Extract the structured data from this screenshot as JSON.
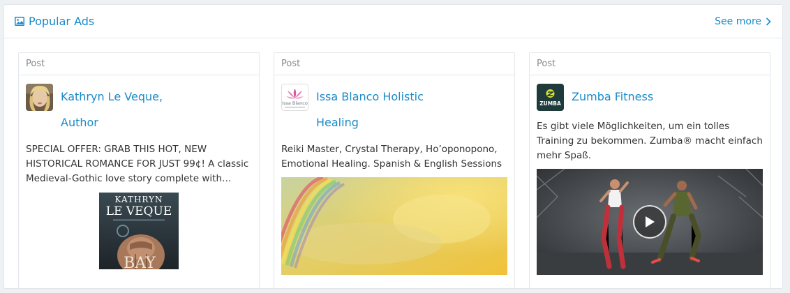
{
  "header": {
    "title": "Popular Ads",
    "title_icon": "image-icon",
    "see_more": "See more",
    "see_more_icon": "chevron-right-icon"
  },
  "colors": {
    "accent": "#1a8ac8",
    "text": "#333333",
    "muted": "#888888",
    "border": "#e4e7eb"
  },
  "cards": [
    {
      "type": "Post",
      "author": "Kathryn Le Veque, Author",
      "text": "SPECIAL OFFER: GRAB THIS HOT, NEW HISTORICAL ROMANCE FOR JUST 99¢! A classic Medieval-Gothic love story complete with ghostly",
      "media": "book-cover-image",
      "cover_title": "KATHRYN LE VEQUE",
      "cover_subtitle": "BAY"
    },
    {
      "type": "Post",
      "author": "Issa Blanco Holistic Healing",
      "text": "Reiki Master, Crystal Therapy, Ho’oponopono, Emotional Healing. Spanish & English Sessions",
      "media": "rainbow-sky-image",
      "logo_text": "Issa Blanco"
    },
    {
      "type": "Post",
      "author": "Zumba Fitness",
      "text": "Es gibt viele Möglichkeiten, um ein tolles Training zu bekommen. Zumba® macht einfach mehr Spaß.",
      "media": "dance-video",
      "logo_text": "ZUMBA"
    }
  ]
}
